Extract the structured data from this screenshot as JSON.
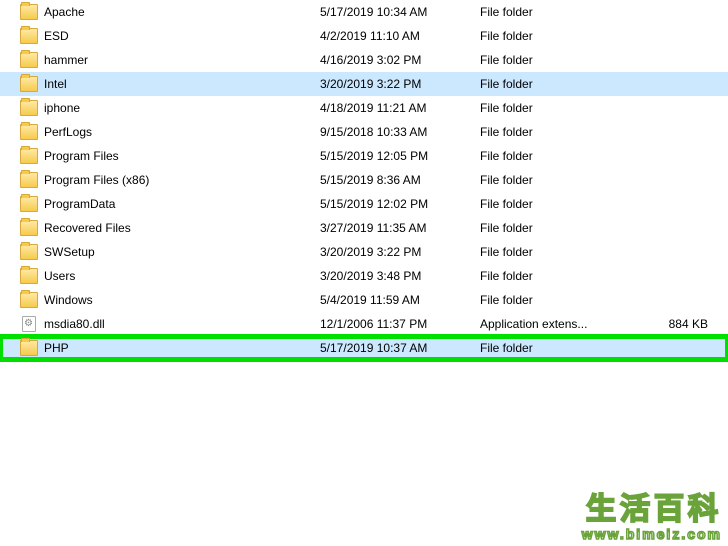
{
  "rows": [
    {
      "icon": "folder",
      "name": "Apache",
      "date": "5/17/2019 10:34 AM",
      "type": "File folder",
      "size": "",
      "selected": false,
      "hl": false
    },
    {
      "icon": "folder",
      "name": "ESD",
      "date": "4/2/2019 11:10 AM",
      "type": "File folder",
      "size": "",
      "selected": false,
      "hl": false
    },
    {
      "icon": "folder",
      "name": "hammer",
      "date": "4/16/2019 3:02 PM",
      "type": "File folder",
      "size": "",
      "selected": false,
      "hl": false
    },
    {
      "icon": "folder",
      "name": "Intel",
      "date": "3/20/2019 3:22 PM",
      "type": "File folder",
      "size": "",
      "selected": true,
      "hl": false
    },
    {
      "icon": "folder",
      "name": "iphone",
      "date": "4/18/2019 11:21 AM",
      "type": "File folder",
      "size": "",
      "selected": false,
      "hl": false
    },
    {
      "icon": "folder",
      "name": "PerfLogs",
      "date": "9/15/2018 10:33 AM",
      "type": "File folder",
      "size": "",
      "selected": false,
      "hl": false
    },
    {
      "icon": "folder",
      "name": "Program Files",
      "date": "5/15/2019 12:05 PM",
      "type": "File folder",
      "size": "",
      "selected": false,
      "hl": false
    },
    {
      "icon": "folder",
      "name": "Program Files (x86)",
      "date": "5/15/2019 8:36 AM",
      "type": "File folder",
      "size": "",
      "selected": false,
      "hl": false
    },
    {
      "icon": "folder",
      "name": "ProgramData",
      "date": "5/15/2019 12:02 PM",
      "type": "File folder",
      "size": "",
      "selected": false,
      "hl": false
    },
    {
      "icon": "folder",
      "name": "Recovered Files",
      "date": "3/27/2019 11:35 AM",
      "type": "File folder",
      "size": "",
      "selected": false,
      "hl": false
    },
    {
      "icon": "folder",
      "name": "SWSetup",
      "date": "3/20/2019 3:22 PM",
      "type": "File folder",
      "size": "",
      "selected": false,
      "hl": false
    },
    {
      "icon": "folder",
      "name": "Users",
      "date": "3/20/2019 3:48 PM",
      "type": "File folder",
      "size": "",
      "selected": false,
      "hl": false
    },
    {
      "icon": "folder",
      "name": "Windows",
      "date": "5/4/2019 11:59 AM",
      "type": "File folder",
      "size": "",
      "selected": false,
      "hl": false
    },
    {
      "icon": "gear",
      "name": "msdia80.dll",
      "date": "12/1/2006 11:37 PM",
      "type": "Application extens...",
      "size": "884 KB",
      "selected": false,
      "hl": false
    },
    {
      "icon": "folder",
      "name": "PHP",
      "date": "5/17/2019 10:37 AM",
      "type": "File folder",
      "size": "",
      "selected": true,
      "hl": true
    }
  ],
  "watermark": {
    "big": "生活百科",
    "url": "www.bimeiz.com"
  }
}
